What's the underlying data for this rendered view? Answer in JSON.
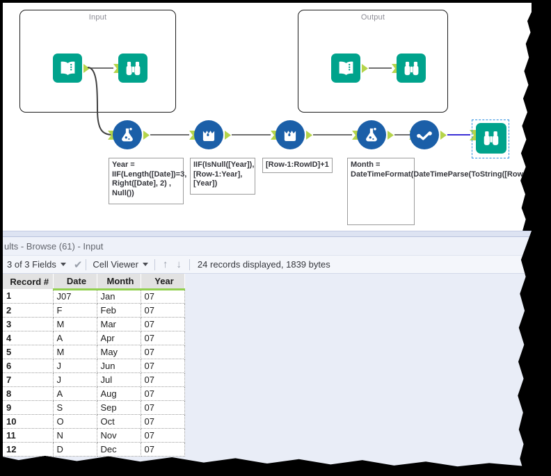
{
  "canvas": {
    "containers": [
      {
        "title": "Input"
      },
      {
        "title": "Output"
      }
    ],
    "tools": [
      {
        "name": "input-data-tool",
        "icon": "book-icon"
      },
      {
        "name": "browse-tool",
        "icon": "binoculars-icon"
      },
      {
        "name": "formula-tool",
        "icon": "flask-icon"
      },
      {
        "name": "multi-row-formula-tool",
        "icon": "bucket-droplet-icon"
      },
      {
        "name": "select-tool",
        "icon": "checkmark-dots-icon"
      }
    ],
    "annotations": [
      "Year = IIF(Length([Date])=3, Right([Date], 2) , Null())",
      "IIF(IsNull([Year]), [Row-1:Year], [Year])",
      "[Row-1:RowID]+1",
      "Month = DateTimeFormat(DateTimeParse(ToString([RowID]),'%m'),'%b')"
    ]
  },
  "results": {
    "title": "ults - Browse (61) - Input",
    "toolbar": {
      "fields_label": "3 of 3 Fields",
      "check_glyph": "✔",
      "viewer_label": "Cell Viewer",
      "up_arrow": "↑",
      "down_arrow": "↓",
      "status": "24 records displayed, 1839 bytes"
    },
    "table": {
      "record_header": "Record #",
      "columns": [
        "Date",
        "Month",
        "Year"
      ],
      "rows": [
        {
          "num": "1",
          "date": "J07",
          "month": "Jan",
          "year": "07"
        },
        {
          "num": "2",
          "date": "F",
          "month": "Feb",
          "year": "07"
        },
        {
          "num": "3",
          "date": "M",
          "month": "Mar",
          "year": "07"
        },
        {
          "num": "4",
          "date": "A",
          "month": "Apr",
          "year": "07"
        },
        {
          "num": "5",
          "date": "M",
          "month": "May",
          "year": "07"
        },
        {
          "num": "6",
          "date": "J",
          "month": "Jun",
          "year": "07"
        },
        {
          "num": "7",
          "date": "J",
          "month": "Jul",
          "year": "07"
        },
        {
          "num": "8",
          "date": "A",
          "month": "Aug",
          "year": "07"
        },
        {
          "num": "9",
          "date": "S",
          "month": "Sep",
          "year": "07"
        },
        {
          "num": "10",
          "date": "O",
          "month": "Oct",
          "year": "07"
        },
        {
          "num": "11",
          "date": "N",
          "month": "Nov",
          "year": "07"
        },
        {
          "num": "12",
          "date": "D",
          "month": "Dec",
          "year": "07"
        }
      ]
    }
  },
  "colors": {
    "tool_teal": "#00a38c",
    "tool_blue": "#1b5fa8",
    "anchor_green": "#b5d44a",
    "field_underline": "#92d050",
    "selection_blue": "#2f8fe0",
    "wire_blue": "#3b2fd6"
  }
}
